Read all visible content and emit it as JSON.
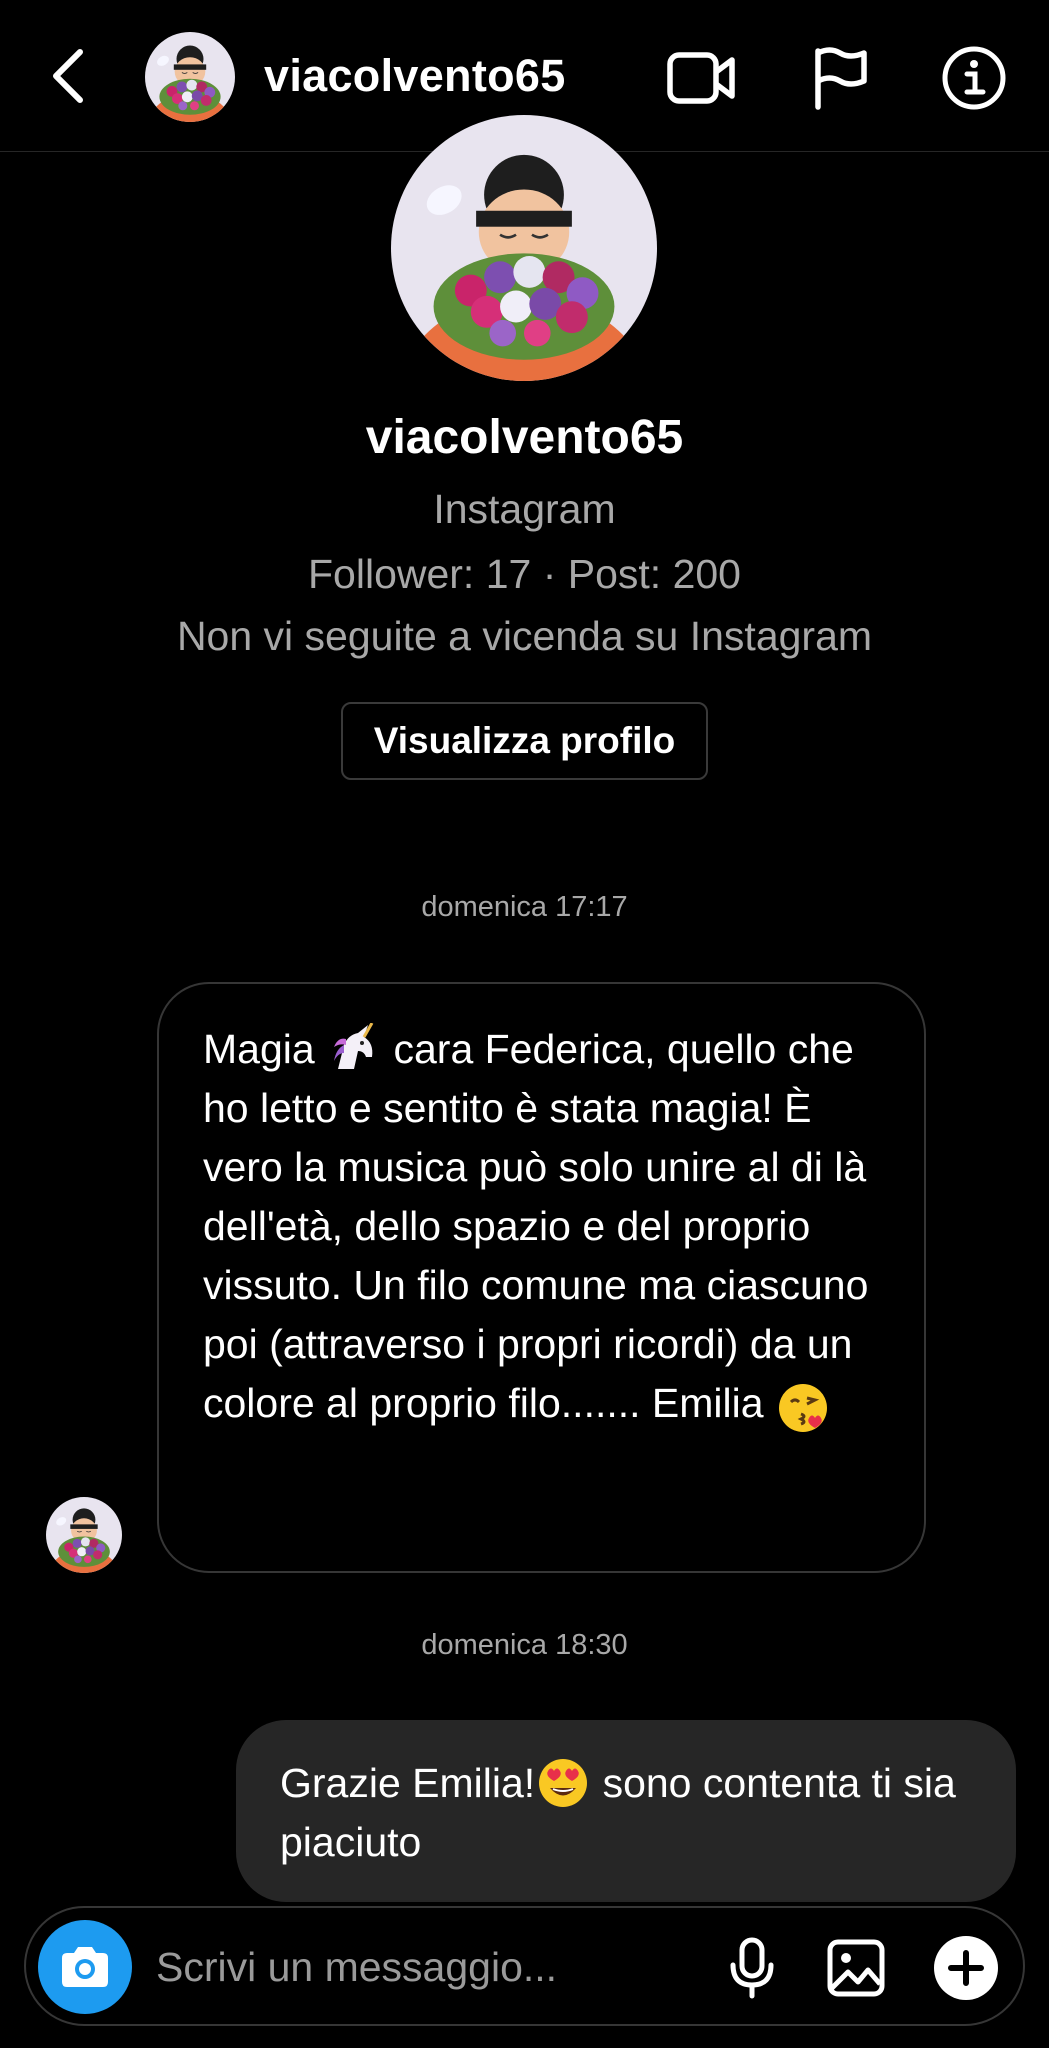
{
  "header": {
    "username": "viacolvento65",
    "back_icon": "chevron-left-icon",
    "video_icon": "video-camera-icon",
    "flag_icon": "flag-icon",
    "info_icon": "info-icon"
  },
  "profile": {
    "name": "viacolvento65",
    "platform": "Instagram",
    "stats": "Follower: 17 · Post: 200",
    "relationship": "Non vi seguite a vicenda su Instagram",
    "view_profile_label": "Visualizza profilo"
  },
  "conversation": {
    "timestamp_1": "domenica 17:17",
    "message_1": {
      "before_emoji": "Magia",
      "emoji_1": "unicorn-emoji",
      "after_emoji": "cara Federica, quello che ho letto e sentito è stata magia! È vero la musica può solo unire al di là dell'età, dello spazio e del proprio vissuto. Un filo comune ma ciascuno poi (attraverso i propri ricordi) da un colore al proprio filo....... Emilia",
      "emoji_2": "kissing-face-emoji"
    },
    "timestamp_2": "domenica 18:30",
    "message_2": {
      "before_emoji": "Grazie Emilia!",
      "emoji": "heart-eyes-emoji",
      "after_emoji": " sono contenta ti sia piaciuto"
    }
  },
  "composer": {
    "placeholder": "Scrivi un messaggio...",
    "camera_icon": "camera-icon",
    "mic_icon": "microphone-icon",
    "gallery_icon": "image-icon",
    "add_icon": "plus-circle-icon"
  },
  "colors": {
    "background": "#000000",
    "outgoing_bubble": "#262626",
    "camera_button": "#1d9bf0",
    "secondary_text": "#a8a8a8"
  }
}
